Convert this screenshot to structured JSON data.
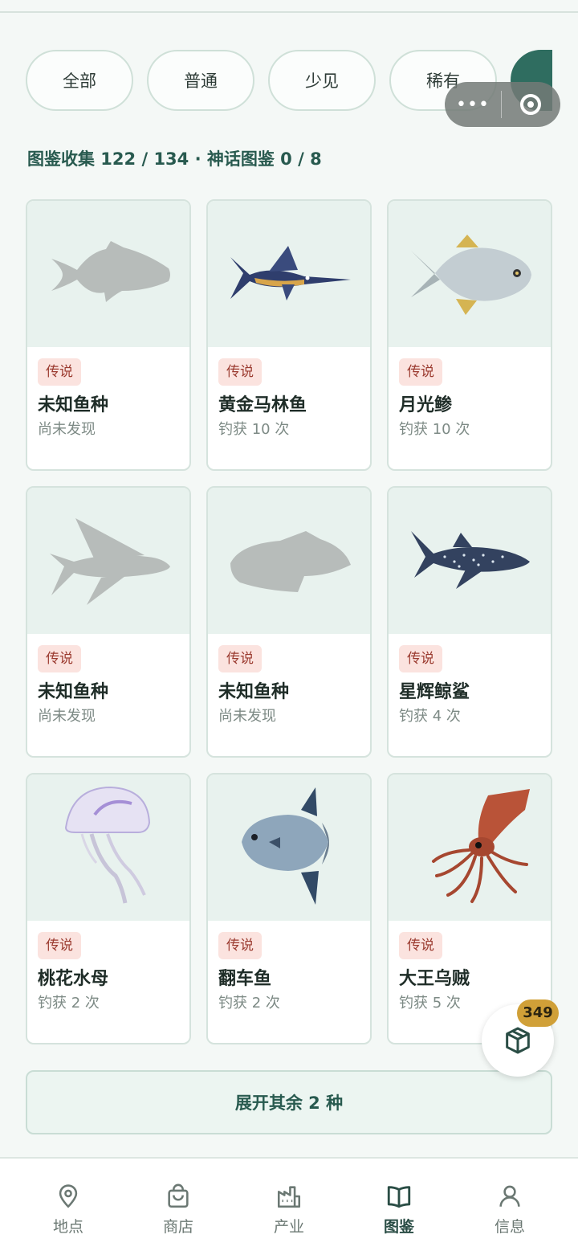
{
  "filters": [
    {
      "label": "全部"
    },
    {
      "label": "普通"
    },
    {
      "label": "少见"
    },
    {
      "label": "稀有"
    }
  ],
  "capsule": {
    "more_icon": "more-dots-icon",
    "close_icon": "close-target-icon"
  },
  "summary": "图鉴收集 122 / 134 · 神话图鉴 0 / 8",
  "cards": [
    {
      "badge": "传说",
      "name": "未知鱼种",
      "count": "尚未发现",
      "icon": "unknown-fish-silhouette"
    },
    {
      "badge": "传说",
      "name": "黄金马林鱼",
      "count": "钓获 10 次",
      "icon": "marlin-icon"
    },
    {
      "badge": "传说",
      "name": "月光鲹",
      "count": "钓获 10 次",
      "icon": "pompano-icon"
    },
    {
      "badge": "传说",
      "name": "未知鱼种",
      "count": "尚未发现",
      "icon": "unknown-flyingfish-silhouette"
    },
    {
      "badge": "传说",
      "name": "未知鱼种",
      "count": "尚未发现",
      "icon": "unknown-fish-silhouette"
    },
    {
      "badge": "传说",
      "name": "星辉鲸鲨",
      "count": "钓获 4 次",
      "icon": "whale-shark-icon"
    },
    {
      "badge": "传说",
      "name": "桃花水母",
      "count": "钓获 2 次",
      "icon": "jellyfish-icon"
    },
    {
      "badge": "传说",
      "name": "翻车鱼",
      "count": "钓获 2 次",
      "icon": "sunfish-icon"
    },
    {
      "badge": "传说",
      "name": "大王乌贼",
      "count": "钓获 5 次",
      "icon": "giant-squid-icon"
    }
  ],
  "expand_label": "展开其余 2 种",
  "fab": {
    "badge": "349",
    "icon": "package-box-icon"
  },
  "tabs": [
    {
      "label": "地点",
      "icon": "location-pin-icon"
    },
    {
      "label": "商店",
      "icon": "shopping-bag-icon"
    },
    {
      "label": "产业",
      "icon": "factory-icon"
    },
    {
      "label": "图鉴",
      "icon": "open-book-icon",
      "active": true
    },
    {
      "label": "信息",
      "icon": "user-icon"
    }
  ],
  "colors": {
    "accent": "#2f6d60",
    "badge_bg": "#fbe3df",
    "badge_text": "#9b3b30",
    "fab_badge": "#d0a038"
  }
}
